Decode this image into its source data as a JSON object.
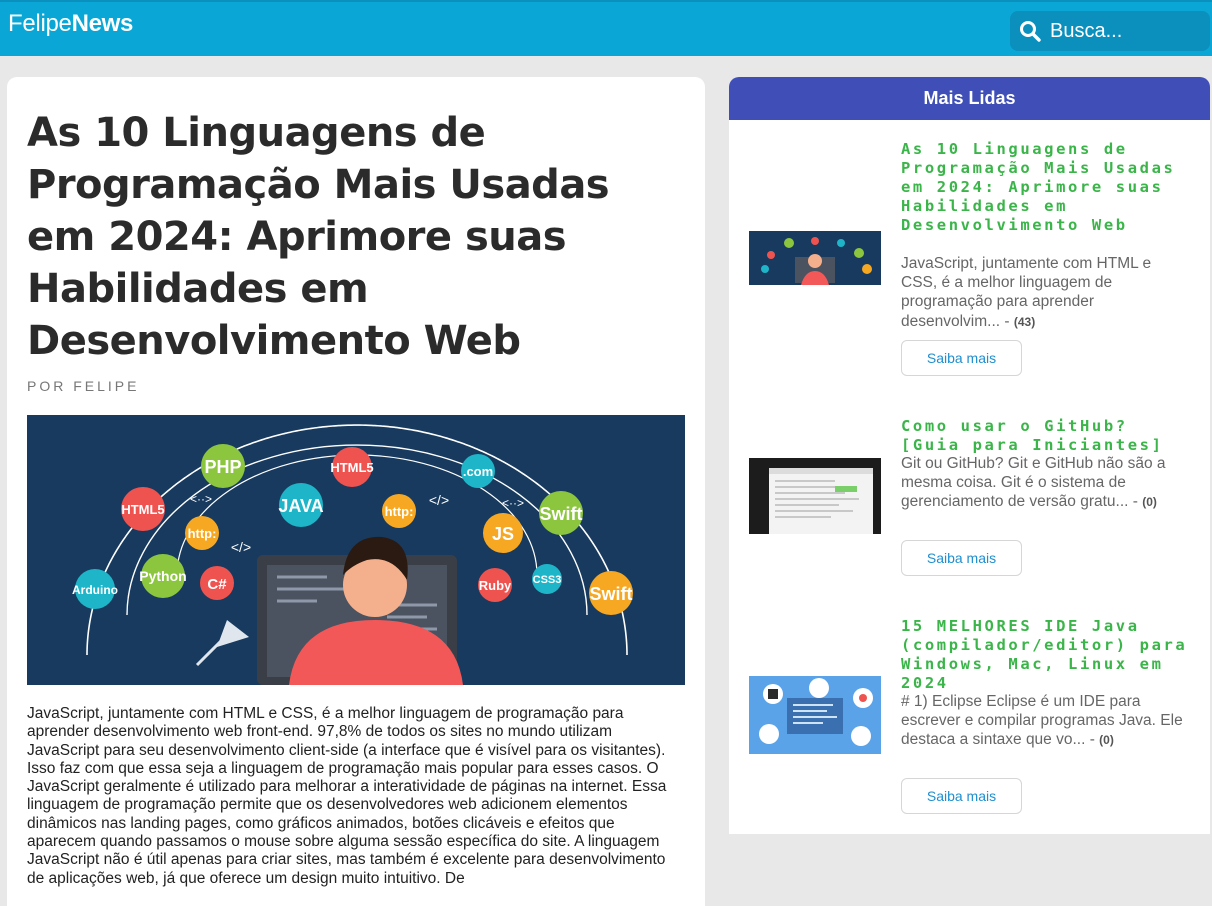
{
  "brand": {
    "light": "Felipe",
    "bold": "News"
  },
  "search": {
    "placeholder": "Busca..."
  },
  "article": {
    "title": "As 10 Linguagens de Programação Mais Usadas em 2024: Aprimore suas Habilidades em Desenvolvimento Web",
    "byline": "POR FELIPE",
    "hero_labels": [
      "PHP",
      "HTML5",
      ".com",
      "HTML5",
      "JAVA",
      "http:",
      "Swift",
      "http:",
      "JS",
      "Python",
      "C#",
      "Ruby",
      "CSS3",
      "Swift",
      "Arduino",
      "</>",
      "<··>",
      "<··>",
      "</>"
    ],
    "body": "JavaScript, juntamente com HTML e CSS, é a melhor linguagem de programação para aprender desenvolvimento web front-end. 97,8% de todos os sites no mundo utilizam JavaScript para seu desenvolvimento client-side (a interface que é visível para os visitantes). Isso faz com que essa seja a linguagem de programação mais popular para esses casos. O JavaScript geralmente é utilizado para melhorar a interatividade de páginas na internet. Essa linguagem de programação permite que os desenvolvedores web adicionem elementos dinâmicos nas landing pages, como gráficos animados, botões clicáveis e efeitos que aparecem quando passamos o mouse sobre alguma sessão específica do site. A linguagem JavaScript não é útil apenas para criar sites, mas também é excelente para desenvolvimento de aplicações web, já que oferece um design muito intuitivo. De"
  },
  "sidebar": {
    "heading": "Mais Lidas",
    "items": [
      {
        "title": "As 10 Linguagens de Programação Mais Usadas em 2024: Aprimore suas Habilidades em Desenvolvimento Web",
        "excerpt": "JavaScript, juntamente com HTML e CSS, é a melhor linguagem de programação para aprender desenvolvim... - ",
        "count": "(43)",
        "button": "Saiba mais"
      },
      {
        "title": "Como usar o GitHub? [Guia para Iniciantes]",
        "excerpt": "Git ou GitHub? Git e GitHub não são a mesma coisa. Git é o sistema de gerenciamento de versão gratu... - ",
        "count": "(0)",
        "button": "Saiba mais"
      },
      {
        "title": "15 MELHORES IDE Java (compilador/editor) para Windows, Mac, Linux em 2024",
        "excerpt": "# 1) Eclipse Eclipse é um IDE para escrever e compilar programas Java. Ele destaca a sintaxe que vo... - ",
        "count": "(0)",
        "button": "Saiba mais"
      }
    ]
  },
  "colors": {
    "topbar": "#0aa7d6",
    "sidebar_header": "#3f4fb7",
    "item_title": "#3bb54a",
    "button_text": "#1e8fcf"
  }
}
